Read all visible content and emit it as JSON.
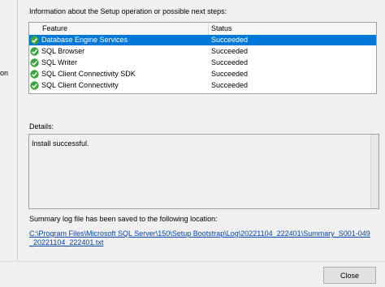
{
  "left_nav": {
    "stub_text": "on"
  },
  "info_label": "Information about the Setup operation or possible next steps:",
  "grid": {
    "columns": [
      "Feature",
      "Status"
    ],
    "rows": [
      {
        "feature": "Database Engine Services",
        "status": "Succeeded",
        "selected": true
      },
      {
        "feature": "SQL Browser",
        "status": "Succeeded"
      },
      {
        "feature": "SQL Writer",
        "status": "Succeeded"
      },
      {
        "feature": "SQL Client Connectivity SDK",
        "status": "Succeeded"
      },
      {
        "feature": "SQL Client Connectivity",
        "status": "Succeeded"
      }
    ]
  },
  "details_label": "Details:",
  "details_text": "Install successful.",
  "summary_label": "Summary log file has been saved to the following location:",
  "log_link": "C:\\Program Files\\Microsoft SQL Server\\150\\Setup Bootstrap\\Log\\20221104_222401\\Summary_S001-049_20221104_222401.txt",
  "footer": {
    "close_label": "Close"
  },
  "colors": {
    "selection": "#0078d7",
    "success_green": "#3aa53a",
    "link": "#0645ad"
  }
}
